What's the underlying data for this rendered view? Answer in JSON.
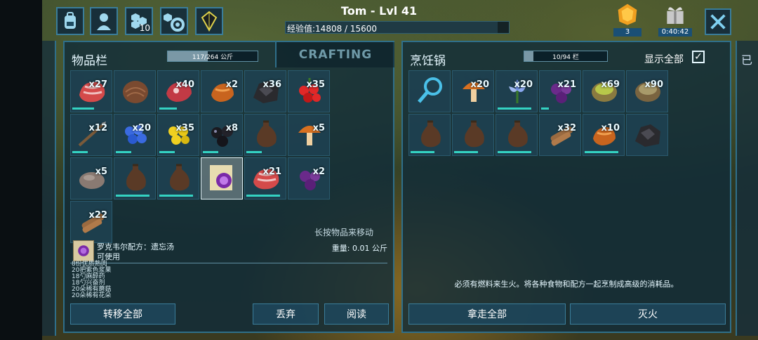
{
  "player": {
    "name": "Tom - Lvl 41",
    "xp_text": "经验值:14808 / 15600",
    "xp_fraction": 0.949
  },
  "top_icons": {
    "engram_count": "10"
  },
  "gems": {
    "count": "3"
  },
  "gift": {
    "timer": "0:40:42"
  },
  "inventory": {
    "title": "物品栏",
    "capacity_text": "117/264 公斤",
    "capacity_fraction": 0.443,
    "crafting_tab": "CRAFTING",
    "hint": "长按物品来移动",
    "slots": [
      {
        "qty": "x27",
        "icon": "raw-meat-icon",
        "dur": 0.55
      },
      {
        "qty": "",
        "icon": "hide-icon",
        "dur": 0
      },
      {
        "qty": "x40",
        "icon": "prime-meat-icon",
        "dur": 0.45
      },
      {
        "qty": "x2",
        "icon": "cooked-meat-icon",
        "dur": 0
      },
      {
        "qty": "x36",
        "icon": "charcoal-icon",
        "dur": 0
      },
      {
        "qty": "x35",
        "icon": "tintoberry-icon",
        "dur": 0
      },
      {
        "qty": "x12",
        "icon": "spear-icon",
        "dur": 0.4
      },
      {
        "qty": "x20",
        "icon": "azulberry-icon",
        "dur": 0.4
      },
      {
        "qty": "x35",
        "icon": "amarberry-icon",
        "dur": 0.4
      },
      {
        "qty": "x8",
        "icon": "narcoberry-icon",
        "dur": 0.4
      },
      {
        "qty": "",
        "icon": "waterskin-icon",
        "dur": 0.4
      },
      {
        "qty": "x5",
        "icon": "mushroom-icon",
        "dur": 0
      },
      {
        "qty": "x5",
        "icon": "stone-icon",
        "dur": 0
      },
      {
        "qty": "",
        "icon": "waterskin-icon",
        "dur": 0.85
      },
      {
        "qty": "",
        "icon": "waterskin-icon",
        "dur": 0.85
      },
      {
        "qty": "",
        "icon": "recipe-note-icon",
        "dur": 0,
        "selected": true
      },
      {
        "qty": "x21",
        "icon": "raw-meat-icon",
        "dur": 0.85
      },
      {
        "qty": "x2",
        "icon": "mejoberry-icon",
        "dur": 0
      },
      {
        "qty": "x22",
        "icon": "wood-icon",
        "dur": 0
      }
    ],
    "detail": {
      "name": "罗克韦尔配方：遗忘汤",
      "usable": "可使用",
      "weight": "重量: 0.01 公斤",
      "ingredients": [
        "8份优质熟肉",
        "20把紫色浆果",
        "18勺麻醉药",
        "18勺兴奋剂",
        "20朵稀有蘑菇",
        "20朵稀有花朵"
      ]
    },
    "buttons": {
      "transfer_all": "转移全部",
      "drop": "丢弃",
      "read": "阅读"
    }
  },
  "cooking_pot": {
    "title": "烹饪锅",
    "capacity_text": "10/94 栏",
    "capacity_fraction": 0.106,
    "show_all_label": "显示全部",
    "show_all_checked": "✓",
    "slots": [
      {
        "qty": "",
        "icon": "search-icon",
        "dur": 0
      },
      {
        "qty": "x20",
        "icon": "mushroom-icon",
        "dur": 0
      },
      {
        "qty": "x20",
        "icon": "rare-flower-icon",
        "dur": 0.85
      },
      {
        "qty": "x21",
        "icon": "mejoberry-icon",
        "dur": 0.2
      },
      {
        "qty": "x69",
        "icon": "stimulant-icon",
        "dur": 0
      },
      {
        "qty": "x90",
        "icon": "narcotic-icon",
        "dur": 0
      },
      {
        "qty": "",
        "icon": "waterskin-icon",
        "dur": 0.6
      },
      {
        "qty": "",
        "icon": "waterskin-icon",
        "dur": 0.6
      },
      {
        "qty": "",
        "icon": "waterskin-icon",
        "dur": 0.85
      },
      {
        "qty": "x32",
        "icon": "wood-icon",
        "dur": 0
      },
      {
        "qty": "x10",
        "icon": "cooked-meat-icon",
        "dur": 0.85
      },
      {
        "qty": "",
        "icon": "charcoal-icon",
        "dur": 0
      }
    ],
    "fuel_msg": "必须有燃料来生火。将各种食物和配方一起烹制成高级的消耗品。",
    "buttons": {
      "take_all": "拿走全部",
      "extinguish": "灭火"
    }
  },
  "right_edge_label": "已",
  "colors": {
    "accent": "#2f6f8a",
    "durability": "#34d2c2",
    "panel": "#102c3a"
  }
}
